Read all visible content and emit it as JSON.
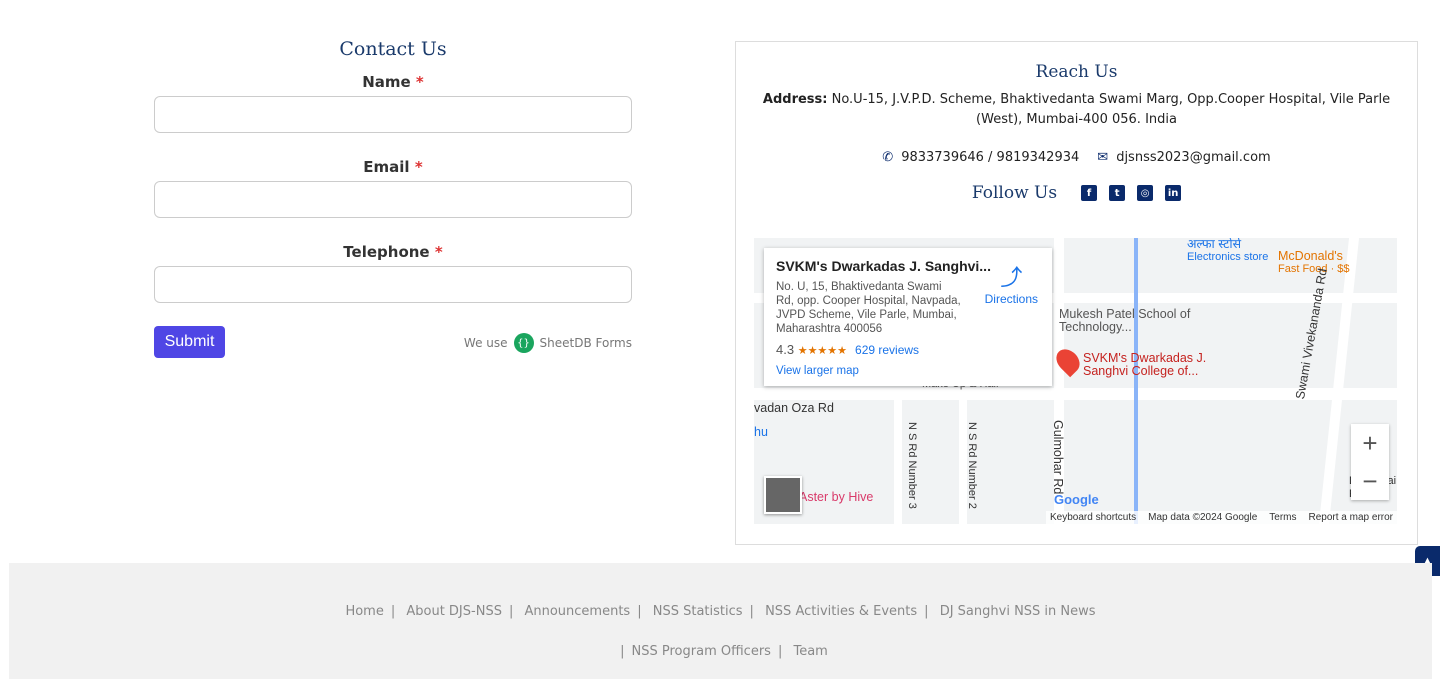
{
  "contact": {
    "title": "Contact Us",
    "fields": [
      {
        "label": "Name",
        "required": "*",
        "value": ""
      },
      {
        "label": "Email",
        "required": "*",
        "value": ""
      },
      {
        "label": "Telephone",
        "required": "*",
        "value": ""
      }
    ],
    "submit": "Submit",
    "we_use": "We use",
    "sheetdb": "SheetDB Forms"
  },
  "reach": {
    "title": "Reach Us",
    "address_label": "Address:",
    "address": " No.U-15, J.V.P.D. Scheme, Bhaktivedanta Swami Marg, Opp.Cooper Hospital, Vile Parle (West), Mumbai-400 056. India",
    "phone": "9833739646 / 9819342934",
    "email": "djsnss2023@gmail.com",
    "follow": "Follow Us",
    "social": [
      "facebook-icon",
      "twitter-icon",
      "instagram-icon",
      "linkedin-icon"
    ]
  },
  "map": {
    "place": "SVKM's Dwarkadas J. Sanghvi...",
    "address": "No. U, 15, Bhaktivedanta Swami Rd, opp. Cooper Hospital, Navpada, JVPD Scheme, Vile Parle, Mumbai, Maharashtra 400056",
    "rating": "4.3",
    "stars": "★★★★★",
    "reviews": "629 reviews",
    "directions": "Directions",
    "larger": "View larger map",
    "labels": {
      "pin": "SVKM's Dwarkadas J. Sanghvi College of...",
      "mukesh": "Mukesh Patel School of Technology...",
      "electronics_hi": "अल्फा स्टोर्स",
      "electronics": "Electronics store",
      "mcd": "McDonald's",
      "mcd_sub": "Fast Food · $$",
      "swami": "Swami Vivekananda Rd",
      "gulmohar": "Gulmohar Rd",
      "ns3": "N S Rd Number 3",
      "ns2": "N S Rd Number 2",
      "oza": "vadan Oza Rd",
      "aster": "Aster by Hive",
      "makeup": "Make Up & Hair",
      "dadabhai": "Dadabhai R",
      "hu": "hu"
    },
    "attribution": [
      "Keyboard shortcuts",
      "Map data ©2024 Google",
      "Terms",
      "Report a map error"
    ],
    "google": "Google",
    "zoom_in": "+",
    "zoom_out": "−"
  },
  "footer": {
    "row1": [
      "Home",
      "About DJS-NSS",
      "Announcements",
      "NSS Statistics",
      "NSS Activities & Events",
      "DJ Sanghvi NSS in News"
    ],
    "row2": [
      "NSS Program Officers",
      "Team"
    ],
    "sep": "|"
  },
  "colors": {
    "accent": "#4f46e5",
    "navy": "#0a2a6b",
    "map_pin": "#ea4335"
  }
}
